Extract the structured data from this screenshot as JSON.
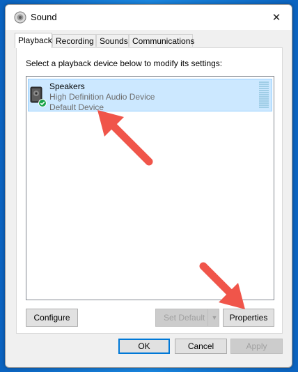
{
  "window": {
    "title": "Sound",
    "close_glyph": "✕"
  },
  "tabs": [
    {
      "label": "Playback",
      "active": true
    },
    {
      "label": "Recording",
      "active": false
    },
    {
      "label": "Sounds",
      "active": false
    },
    {
      "label": "Communications",
      "active": false
    }
  ],
  "playback": {
    "instructions": "Select a playback device below to modify its settings:",
    "devices": [
      {
        "name": "Speakers",
        "description": "High Definition Audio Device",
        "status": "Default Device",
        "icon": "speaker-icon",
        "badge_icon": "checkmark-icon",
        "selected": true
      }
    ]
  },
  "buttons": {
    "configure": "Configure",
    "set_default": "Set Default",
    "set_default_arrow": "▼",
    "properties": "Properties",
    "ok": "OK",
    "cancel": "Cancel",
    "apply": "Apply"
  },
  "colors": {
    "desktop": "#0a6fc9",
    "selection": "#cce8ff",
    "annotation_arrow": "#f0554a",
    "default_button_border": "#0078d7"
  }
}
